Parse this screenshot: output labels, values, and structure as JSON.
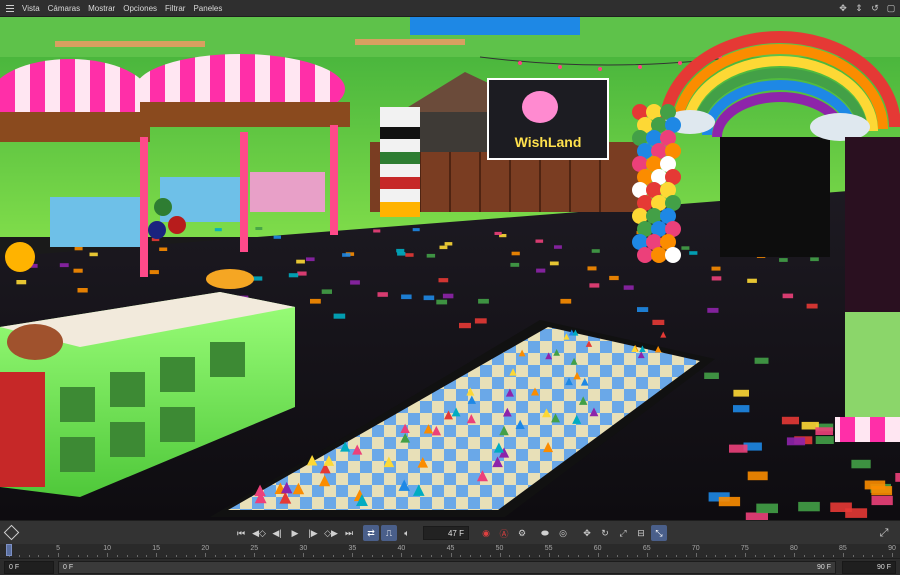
{
  "menubar": {
    "items": [
      {
        "id": "vista",
        "label": "Vista"
      },
      {
        "id": "camaras",
        "label": "Cámaras"
      },
      {
        "id": "mostrar",
        "label": "Mostrar"
      },
      {
        "id": "opciones",
        "label": "Opciones"
      },
      {
        "id": "filtrar",
        "label": "Filtrar"
      },
      {
        "id": "paneles",
        "label": "Paneles"
      }
    ],
    "right_icons": [
      "move-view-icon",
      "pan-view-icon",
      "zoom-view-icon",
      "maximize-view-icon"
    ]
  },
  "viewport": {
    "sign_text": "WishLand"
  },
  "transport": {
    "current_frame": "47 F",
    "buttons": [
      "go-to-start-icon",
      "previous-key-icon",
      "step-back-icon",
      "play-icon",
      "step-forward-icon",
      "next-key-icon",
      "go-to-end-icon",
      "loop-icon",
      "playback-rate-icon",
      "sound-icon",
      "record-icon",
      "autokey-icon",
      "keyframe-settings-icon",
      "key-selection-icon",
      "fcurve-icon",
      "move-key-icon",
      "rotate-key-icon",
      "scale-key-icon",
      "param-key-icon",
      "pla-key-icon",
      "timeline-icon"
    ]
  },
  "timeline": {
    "ticks": [
      "0",
      "5",
      "10",
      "15",
      "20",
      "25",
      "30",
      "35",
      "40",
      "45",
      "50",
      "55",
      "60",
      "65",
      "70",
      "75",
      "80",
      "85",
      "90"
    ],
    "playhead_frame": 0
  },
  "range": {
    "start": "0 F",
    "preview_start": "0 F",
    "preview_end": "90 F",
    "end": "90 F"
  },
  "colors": {
    "ui_bg": "#2b2b2b",
    "accent": "#4a5f8a",
    "record": "#e04040"
  }
}
